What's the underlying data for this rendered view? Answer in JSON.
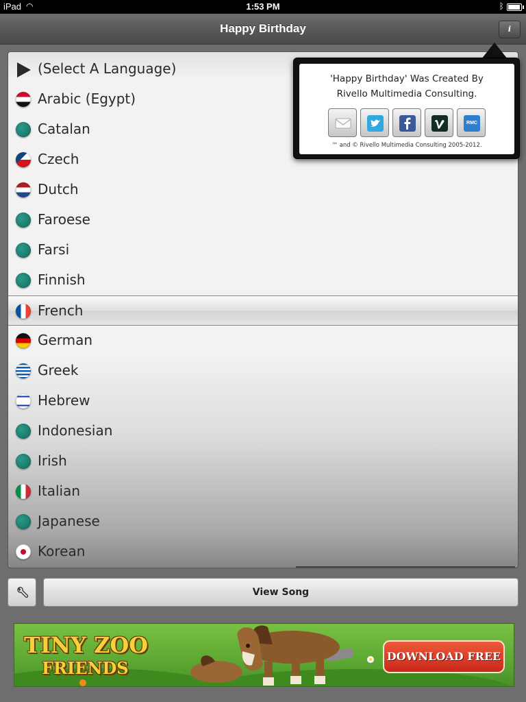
{
  "status_bar": {
    "device": "iPad",
    "time": "1:53 PM"
  },
  "nav": {
    "title": "Happy Birthday",
    "info_label": "i"
  },
  "language_list": {
    "items": [
      {
        "label": "(Select A Language)",
        "flag": "play-arrow"
      },
      {
        "label": "Arabic (Egypt)",
        "flag": "egypt"
      },
      {
        "label": "Catalan",
        "flag": "teal-dot"
      },
      {
        "label": "Czech",
        "flag": "czech"
      },
      {
        "label": "Dutch",
        "flag": "netherlands"
      },
      {
        "label": "Faroese",
        "flag": "teal-dot"
      },
      {
        "label": "Farsi",
        "flag": "teal-dot"
      },
      {
        "label": "Finnish",
        "flag": "teal-dot"
      },
      {
        "label": "French",
        "flag": "france",
        "selected": true
      },
      {
        "label": "German",
        "flag": "germany"
      },
      {
        "label": "Greek",
        "flag": "greece"
      },
      {
        "label": "Hebrew",
        "flag": "israel"
      },
      {
        "label": "Indonesian",
        "flag": "teal-dot"
      },
      {
        "label": "Irish",
        "flag": "teal-dot"
      },
      {
        "label": "Italian",
        "flag": "italy"
      },
      {
        "label": "Japanese",
        "flag": "teal-dot"
      },
      {
        "label": "Korean",
        "flag": "korea"
      }
    ]
  },
  "popover": {
    "line1": "'Happy Birthday' Was Created By",
    "line2": "Rivello Multimedia Consulting.",
    "buttons": [
      {
        "icon": "mail-icon"
      },
      {
        "icon": "twitter-icon"
      },
      {
        "icon": "facebook-icon"
      },
      {
        "icon": "vimeo-icon"
      },
      {
        "icon": "rmc-icon",
        "text": "RMC"
      }
    ],
    "footer": "™ and © Rivello Multimedia Consulting 2005-2012."
  },
  "toolbar": {
    "view_song_label": "View Song"
  },
  "ad": {
    "line1": "TINY ZOO",
    "line2": "FRIENDS",
    "cta": "DOWNLOAD FREE"
  },
  "colors": {
    "accent_teal": "#17766a",
    "nav_bar": "#555555",
    "ad_green": "#5ca832",
    "ad_red": "#d8321f"
  }
}
